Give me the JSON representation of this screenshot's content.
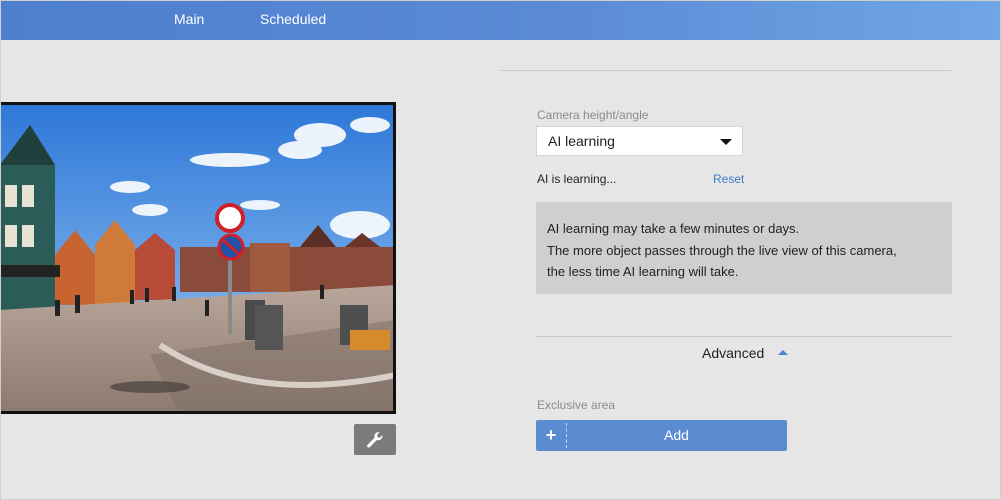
{
  "tabs": {
    "main": "Main",
    "scheduled": "Scheduled"
  },
  "preview": {
    "wrench_icon": "wrench-icon"
  },
  "camera": {
    "label": "Camera height/angle",
    "selected": "AI learning",
    "status": "AI is learning...",
    "reset": "Reset"
  },
  "info": {
    "line1": "AI learning may take a few minutes or days.",
    "line2": "The more object passes through the live view of this camera,",
    "line3": "the less time AI learning will take."
  },
  "advanced": {
    "label": "Advanced"
  },
  "exclusive": {
    "label": "Exclusive area",
    "add_label": "Add",
    "plus": "+"
  },
  "colors": {
    "accent": "#5b8bd1",
    "link": "#3f79c8",
    "topbar": "#4d7fcf"
  }
}
